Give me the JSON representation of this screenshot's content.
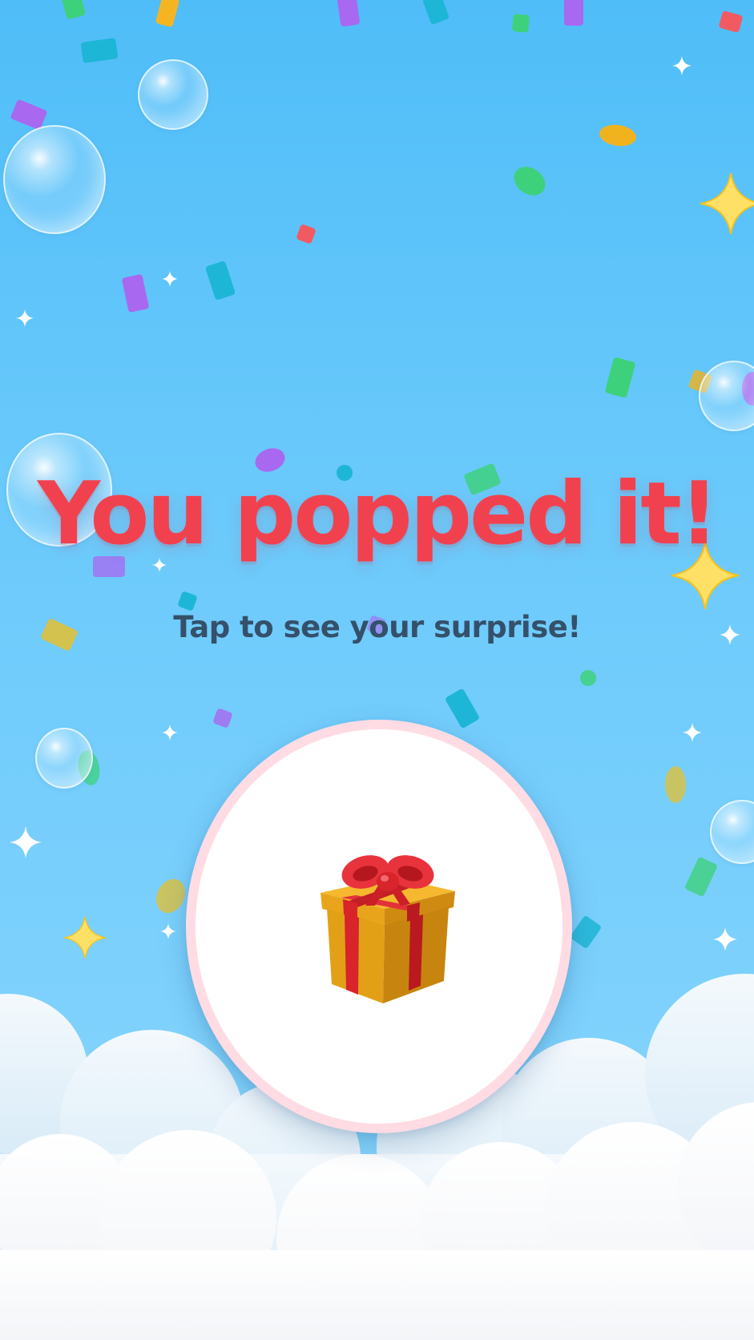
{
  "screen": {
    "title": "You popped it!",
    "subtitle": "Tap to see your surprise!"
  },
  "gift_button": {
    "icon": "gift-icon"
  },
  "colors": {
    "background_top": "#4fbdf8",
    "background_bottom": "#8ad6fd",
    "title": "#f2414e",
    "subtitle": "#35506a",
    "button_ring": "#ffdce4",
    "gift_box": "#e2a017",
    "gift_ribbon": "#d8242b"
  },
  "decorations": {
    "icons": [
      "confetti",
      "bubble-icon",
      "sparkle-icon",
      "cloud"
    ]
  }
}
